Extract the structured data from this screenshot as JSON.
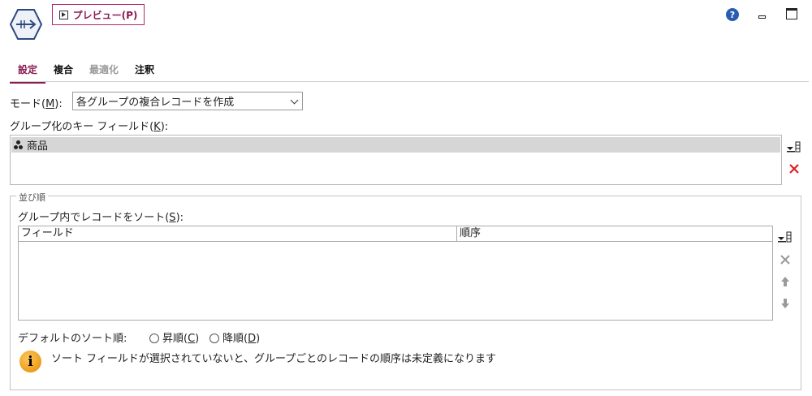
{
  "header": {
    "preview_label": "プレビュー(P)",
    "help_glyph": "?"
  },
  "tabs": [
    {
      "label": "設定",
      "state": "active"
    },
    {
      "label": "複合",
      "state": "normal"
    },
    {
      "label": "最適化",
      "state": "disabled"
    },
    {
      "label": "注釈",
      "state": "normal"
    }
  ],
  "mode": {
    "label_prefix": "モード(",
    "mnemonic": "M",
    "label_suffix": "):",
    "selected": "各グループの複合レコードを作成"
  },
  "key_fields": {
    "label_prefix": "グループ化のキー フィールド(",
    "mnemonic": "K",
    "label_suffix": "):",
    "items": [
      {
        "name": "商品",
        "icon": "set-icon"
      }
    ]
  },
  "sort_group": {
    "legend": "並び順",
    "label_prefix": "グループ内でレコードをソート(",
    "mnemonic": "S",
    "label_suffix": "):",
    "columns": [
      "フィールド",
      "順序"
    ],
    "rows": []
  },
  "default_sort": {
    "label": "デフォルトのソート順:",
    "asc_prefix": "昇順(",
    "asc_mnemonic": "C",
    "asc_suffix": ")",
    "desc_prefix": "降順(",
    "desc_mnemonic": "D",
    "desc_suffix": ")"
  },
  "info": {
    "glyph": "i",
    "message": "ソート フィールドが選択されていないと、グループごとのレコードの順序は未定義になります"
  },
  "colors": {
    "accent": "#8a1c53",
    "delete_red": "#e02020",
    "info_orange": "#e38a00"
  }
}
